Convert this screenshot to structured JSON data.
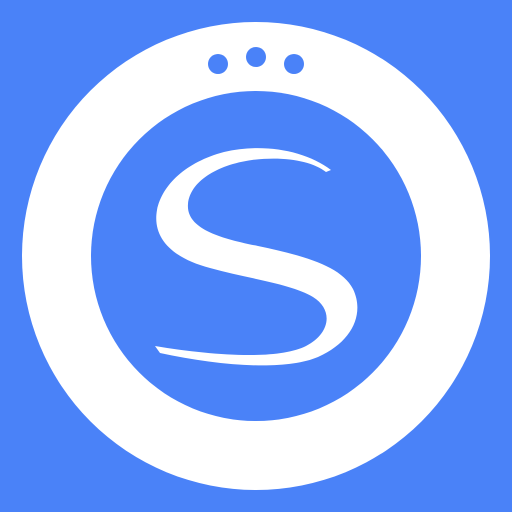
{
  "icon": {
    "name": "sony-camera-app-icon",
    "letter": "S",
    "colors": {
      "background": "#4a82f8",
      "ring": "#ffffff",
      "inner_disc": "#4a82f8",
      "letter": "#ffffff",
      "dots": "#4a82f8"
    },
    "dot_count": 3
  }
}
